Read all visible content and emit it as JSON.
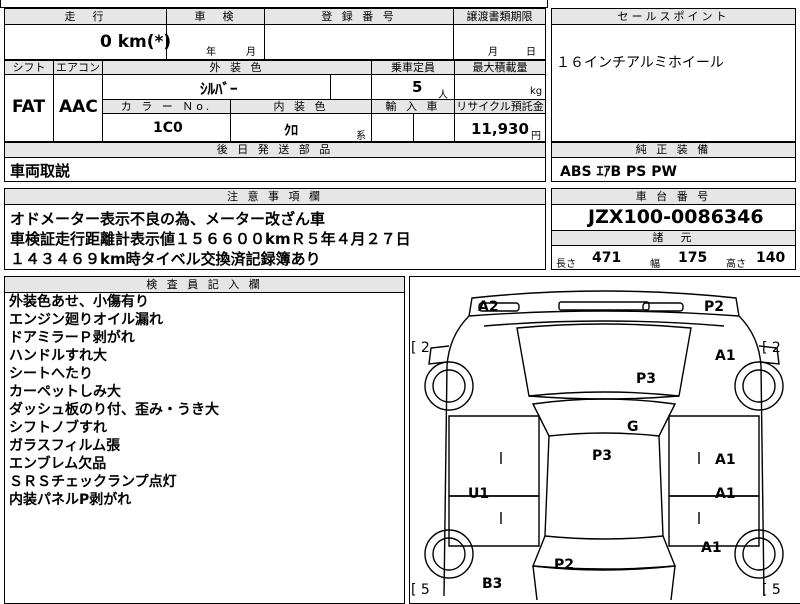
{
  "top": {
    "mileage_header": "走　行",
    "inspection_header": "車　検",
    "registration_header": "登 録 番 号",
    "transfer_header": "譲渡書類期限",
    "salespoint_header": "セールスポイント",
    "mileage_value": "0 km(*)",
    "inspection_year_label": "年",
    "inspection_month_label": "月",
    "transfer_month_label": "月",
    "transfer_day_label": "日"
  },
  "spec": {
    "shift_header": "シフト",
    "aircon_header": "エアコン",
    "exterior_color_header": "外 装 色",
    "capacity_header": "乗車定員",
    "max_load_header": "最大積載量",
    "shift_value": "FAT",
    "aircon_value": "AAC",
    "exterior_color_value": "ｼﾙﾊﾞｰ",
    "capacity_value": "5",
    "capacity_unit": "人",
    "load_unit": "kg",
    "color_no_header": "カ ラ ー Ｎo.",
    "interior_color_header": "内 装 色",
    "import_header": "輸 入 車",
    "recycle_header": "リサイクル預託金",
    "color_no_value": "1C0",
    "interior_color_value": "ｸﾛ",
    "interior_suffix": "系",
    "recycle_value": "11,930",
    "recycle_unit": "円"
  },
  "salespoint": {
    "text": "１６インチアルミホイール"
  },
  "later_parts": {
    "header": "後 日 発 送 部 品",
    "value": "車両取説"
  },
  "equipment": {
    "header": "純 正 装 備",
    "value": "ABS ｴｱB PS PW"
  },
  "notes": {
    "header": "注 意 事 項 欄",
    "lines": [
      "オドメーター表示不良の為、メーター改ざん車",
      "車検証走行距離計表示値１５６６００kmＲ５年４月２７日",
      "１４３４６９km時タイベル交換済記録簿あり"
    ]
  },
  "chassis": {
    "header": "車 台 番 号",
    "value": "JZX100-0086346",
    "dims_header": "諸　元",
    "length_label": "長さ",
    "length_value": "471",
    "width_label": "幅",
    "width_value": "175",
    "height_label": "高さ",
    "height_value": "140"
  },
  "inspector": {
    "header": "検 査 員 記 入 欄",
    "lines": [
      "外装色あせ、小傷有り",
      "エンジン廻りオイル漏れ",
      "ドアミラーＰ剥がれ",
      "ハンドルすれ大",
      "シートへたり",
      "カーペットしみ大",
      "ダッシュ板のり付、歪み・うき大",
      "シフトノブすれ",
      "ガラスフィルム張",
      "エンブレム欠品",
      "ＳＲＳチェックランプ点灯",
      "内装パネルP剥がれ"
    ]
  },
  "diagram": {
    "labels": {
      "a2": "A2",
      "p2_top": "P2",
      "a1_front_right": "A1",
      "p3_hood": "P3",
      "g": "G",
      "p3_roof": "P3",
      "a1_door1": "A1",
      "u1": "U1",
      "a1_door2": "A1",
      "a1_rear": "A1",
      "p2_trunk": "P2",
      "b3": "B3"
    },
    "bracket_left_top": "[ 2",
    "bracket_right_top": "[ 2",
    "bracket_left_bottom": "[ 5",
    "bracket_right_bottom": "[ 5"
  }
}
